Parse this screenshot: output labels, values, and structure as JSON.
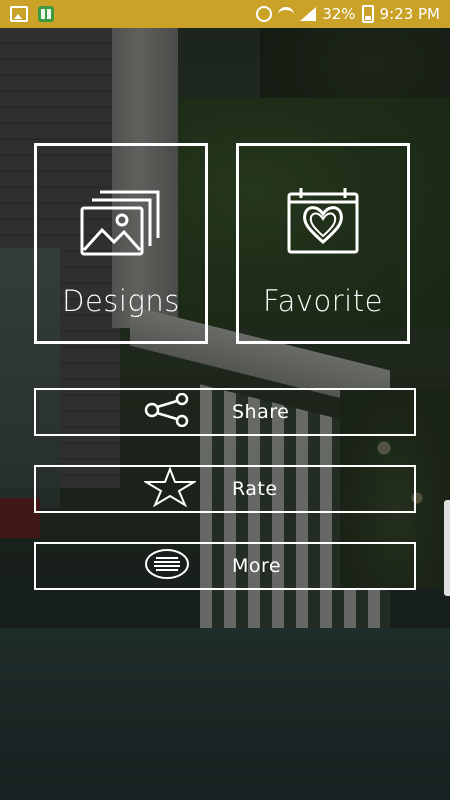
{
  "status_bar": {
    "battery": "32%",
    "time": "9:23 PM",
    "icons": [
      "image-icon",
      "app-grid-icon",
      "alarm-icon",
      "wifi-icon",
      "signal-icon",
      "battery-icon"
    ]
  },
  "menu": {
    "tiles": [
      {
        "label": "Designs",
        "icon": "stacked-images-icon"
      },
      {
        "label": "Favorite",
        "icon": "heart-calendar-icon"
      }
    ],
    "actions": [
      {
        "label": "Share",
        "icon": "share-icon"
      },
      {
        "label": "Rate",
        "icon": "star-icon"
      },
      {
        "label": "More",
        "icon": "menu-circle-icon"
      }
    ]
  },
  "colors": {
    "status_bar": "#c9a227",
    "foreground": "#ffffff"
  }
}
